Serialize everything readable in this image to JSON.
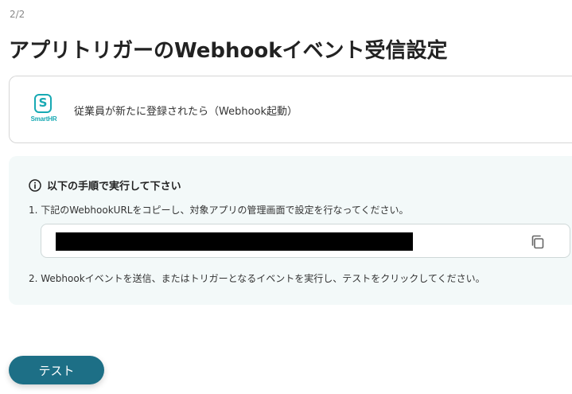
{
  "step_indicator": "2/2",
  "page_title": "アプリトリガーのWebhookイベント受信設定",
  "app": {
    "logo_text": "SmartHR",
    "logo_icon": "smarthr-logo-icon",
    "event_label": "従業員が新たに登録されたら（Webhook起動）"
  },
  "instructions": {
    "heading": "以下の手順で実行して下さい",
    "step1": "1. 下記のWebhookURLをコピーし、対象アプリの管理画面で設定を行なってください。",
    "url_value": "",
    "copy_icon": "copy-icon",
    "step2": "2. Webhookイベントを送信、またはトリガーとなるイベントを実行し、テストをクリックしてください。"
  },
  "test_button_label": "テスト",
  "colors": {
    "accent": "#1d6f86",
    "smarthr_teal": "#17a9b3",
    "panel_bg": "#f3f9f9"
  }
}
